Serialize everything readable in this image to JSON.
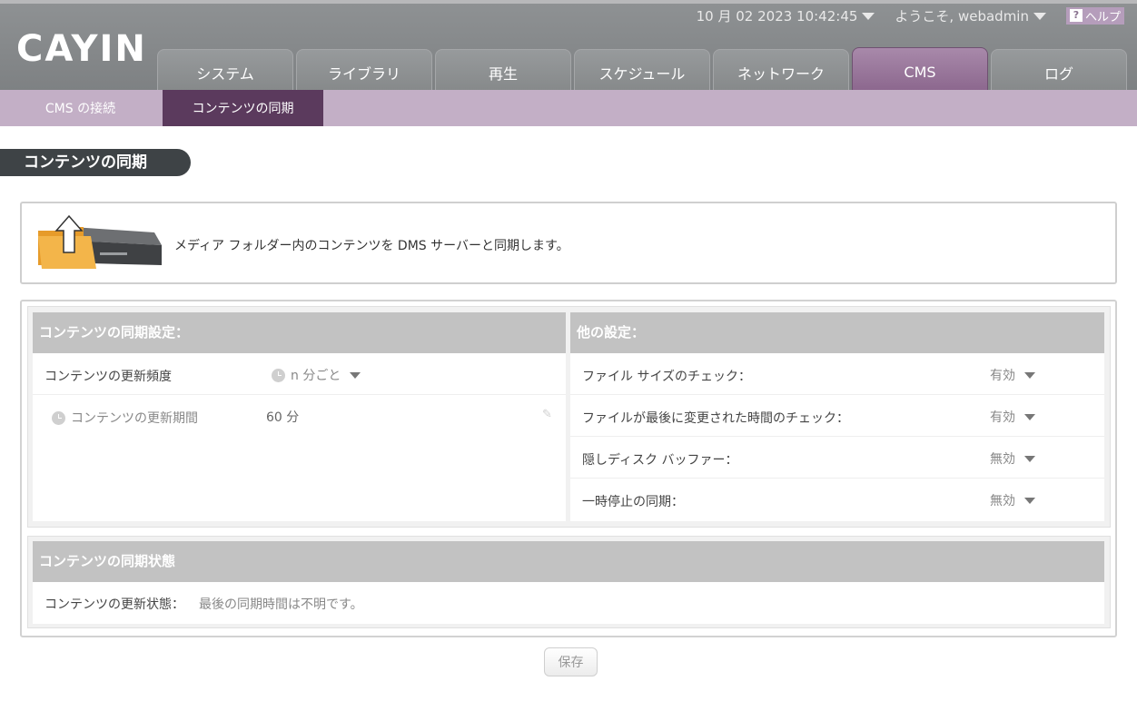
{
  "app": {
    "logo_text": "CAYIN"
  },
  "topbar": {
    "datetime": "10 月 02 2023 10:42:45",
    "welcome": "ようこそ, webadmin",
    "help_icon": "?",
    "help_label": "ヘルプ"
  },
  "tabs": [
    {
      "label": "システム"
    },
    {
      "label": "ライブラリ"
    },
    {
      "label": "再生"
    },
    {
      "label": "スケジュール"
    },
    {
      "label": "ネットワーク"
    },
    {
      "label": "CMS"
    },
    {
      "label": "ログ"
    }
  ],
  "subnav": [
    {
      "label": "CMS の接続"
    },
    {
      "label": "コンテンツの同期"
    }
  ],
  "page_title": "コンテンツの同期",
  "description": "メディア フォルダー内のコンテンツを DMS サーバーと同期します。",
  "sync_settings": {
    "title": "コンテンツの同期設定：",
    "frequency_label": "コンテンツの更新頻度",
    "frequency_value": "n 分ごと",
    "period_label": "コンテンツの更新期間",
    "period_value": "60 分"
  },
  "other_settings": {
    "title": "他の設定：",
    "rows": [
      {
        "label": "ファイル サイズのチェック：",
        "value": "有効"
      },
      {
        "label": "ファイルが最後に変更された時間のチェック：",
        "value": "有効"
      },
      {
        "label": "隠しディスク バッファー：",
        "value": "無効"
      },
      {
        "label": "一時停止の同期：",
        "value": "無効"
      }
    ]
  },
  "sync_status": {
    "title": "コンテンツの同期状態",
    "label": "コンテンツの更新状態：",
    "value": "最後の同期時間は不明です。"
  },
  "save_label": "保存",
  "colors": {
    "accent": "#8a658c",
    "subnav": "#c3afc6",
    "subnav_active": "#5b3a5d",
    "header": "#858889"
  }
}
